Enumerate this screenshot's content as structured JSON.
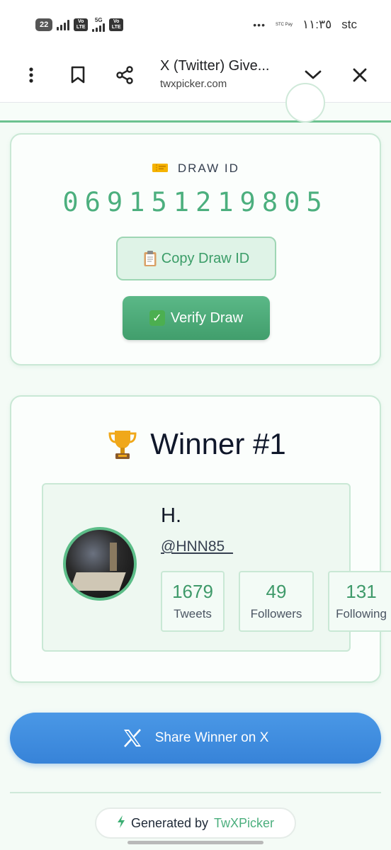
{
  "status_bar": {
    "battery": "22",
    "volte_1": "Vo LTE",
    "network_5g": "5G",
    "volte_2": "Vo LTE",
    "more": "•••",
    "operator_tiny": "STC Pay",
    "time": "١١:٣٥",
    "carrier": "stc"
  },
  "browser": {
    "title": "X (Twitter) Give...",
    "url": "twxpicker.com"
  },
  "draw": {
    "icon": "ticket-icon",
    "label": "DRAW ID",
    "id": "069151219805",
    "copy_label": "Copy Draw ID",
    "verify_label": "Verify Draw"
  },
  "winner": {
    "trophy": "🏆",
    "title": "Winner #1",
    "name": "H.",
    "handle": "@HNN85_",
    "stats": [
      {
        "value": "1679",
        "label": "Tweets"
      },
      {
        "value": "49",
        "label": "Followers"
      },
      {
        "value": "131",
        "label": "Following"
      }
    ]
  },
  "share": {
    "icon": "x",
    "label": "Share Winner on X"
  },
  "footer": {
    "generated_by": "Generated by",
    "brand": "TwXPicker"
  },
  "colors": {
    "accent_green": "#4caf7e",
    "button_blue": "#3783d8",
    "card_border": "#c9e8d5"
  }
}
